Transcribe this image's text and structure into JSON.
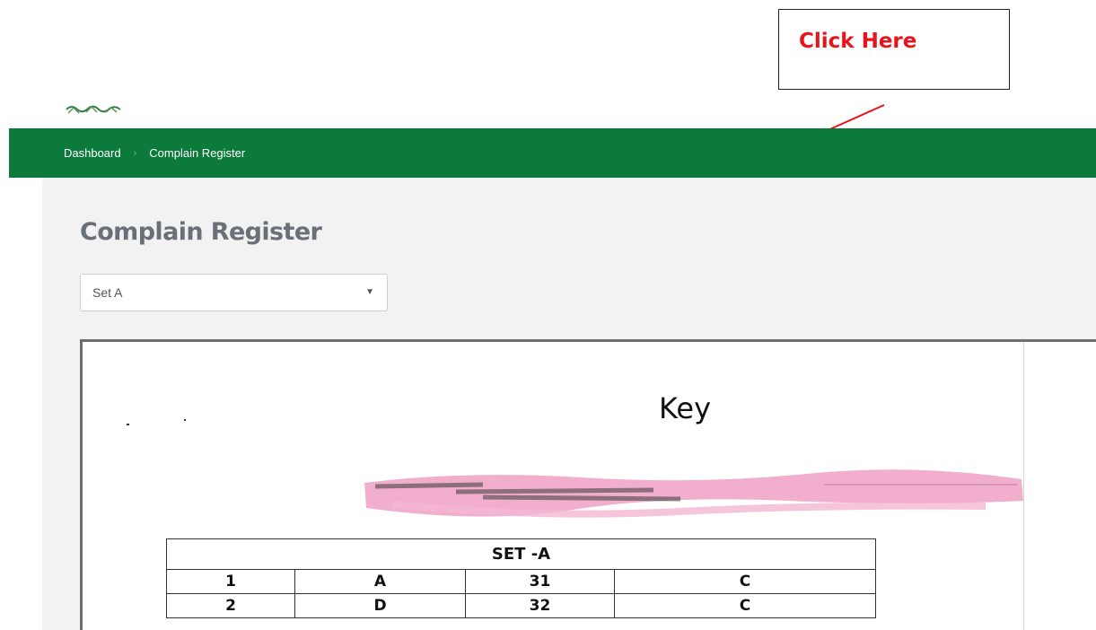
{
  "annotation": {
    "callout_text": "Click Here",
    "text_color": "#e8141c",
    "arrow_color": "#e8141c"
  },
  "navbar": {
    "color": "#0b7a3b",
    "breadcrumb": {
      "home": "Dashboard",
      "separator": "›",
      "current": "Complain Register"
    }
  },
  "main": {
    "page_title": "Complain Register",
    "set_select": {
      "selected": "Set A",
      "caret": "▼"
    }
  },
  "document": {
    "title": "Key",
    "table": {
      "header": "SET -A",
      "rows": [
        [
          "1",
          "A",
          "31",
          "C"
        ],
        [
          "2",
          "D",
          "32",
          "C"
        ]
      ]
    }
  }
}
